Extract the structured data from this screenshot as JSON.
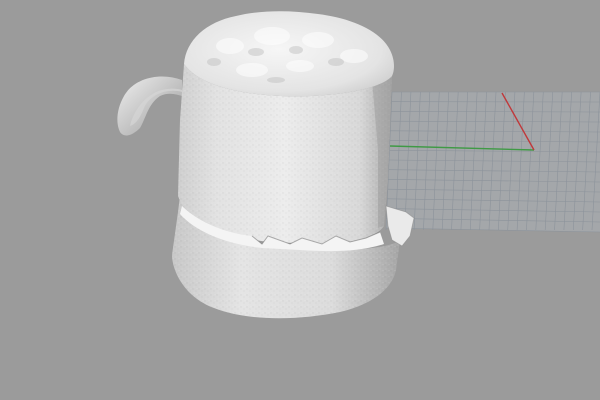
{
  "viewport": {
    "projection": "perspective",
    "display_mode": "shaded",
    "background_color": "#9b9b9b"
  },
  "construction_grid": {
    "visible": true,
    "line_color": "#8c939b",
    "background_color": "#a4a7aa",
    "x_axis_color": "#c0383a",
    "y_axis_color": "#3f9a45"
  },
  "model": {
    "object": "scanned mug",
    "surface_color": "#e6e6e6",
    "shadow_color": "#8a8a8a",
    "parts": [
      "cup-body",
      "top-foam",
      "handle",
      "bottom-band"
    ]
  }
}
